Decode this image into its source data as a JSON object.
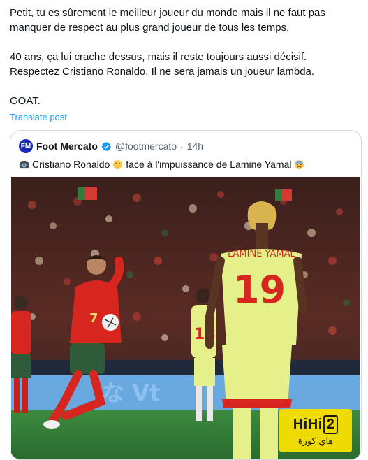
{
  "post": {
    "lines_block1": [
      "Petit, tu es sûrement le meilleur joueur du monde mais il ne faut pas",
      "manquer de respect au plus grand joueur de tous les temps."
    ],
    "lines_block2": [
      "40 ans, ça lui crache dessus, mais il reste toujours aussi décisif.",
      "Respectez Cristiano Ronaldo. Il ne sera jamais un joueur lambda."
    ],
    "lines_block3": [
      "GOAT."
    ],
    "translate_label": "Translate post"
  },
  "quote": {
    "author_name": "Foot Mercato",
    "handle": "@footmercato",
    "separator": "·",
    "time": "14h",
    "text_part1": "Cristiano Ronaldo",
    "text_part2": "face à l'impuissance de Lamine Yamal",
    "emojis": [
      "camera-emoji",
      "shushing-face-emoji",
      "anxious-face-emoji"
    ]
  },
  "media": {
    "left_player_number": "7",
    "right_player_name": "LAMINE YAMAL",
    "right_player_number": "19",
    "mid_player_number": "18",
    "colors": {
      "portugal_red": "#d6261f",
      "spain_yellow": "#e6f08a",
      "pitch_green": "#2f7a35"
    }
  },
  "watermark": {
    "logo_text": "HiHi",
    "logo_number": "2",
    "arabic_text": "هاي كورة"
  },
  "colors": {
    "link": "#1d9bf0",
    "verified": "#1d9bf0",
    "muted": "#536471"
  }
}
